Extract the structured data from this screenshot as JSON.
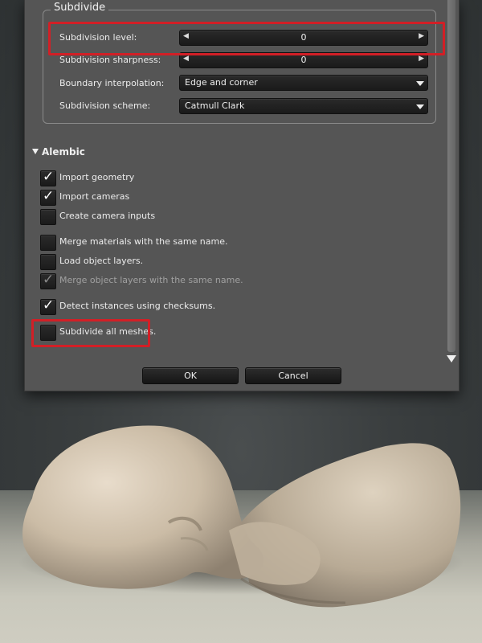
{
  "subdivide": {
    "title": "Subdivide",
    "level": {
      "label": "Subdivision level:",
      "value": "0"
    },
    "sharpness": {
      "label": "Subdivision sharpness:",
      "value": "0"
    },
    "boundary": {
      "label": "Boundary interpolation:",
      "value": "Edge and corner"
    },
    "scheme": {
      "label": "Subdivision scheme:",
      "value": "Catmull Clark"
    }
  },
  "alembic": {
    "title": "Alembic",
    "options": [
      {
        "label": "Import geometry",
        "checked": true,
        "enabled": true
      },
      {
        "label": "Import cameras",
        "checked": true,
        "enabled": true
      },
      {
        "label": "Create camera inputs",
        "checked": false,
        "enabled": true
      },
      {
        "label": "Merge materials with the same name.",
        "checked": false,
        "enabled": true
      },
      {
        "label": "Load object layers.",
        "checked": false,
        "enabled": true
      },
      {
        "label": "Merge object layers with the same name.",
        "checked": true,
        "enabled": false
      },
      {
        "label": "Detect instances using checksums.",
        "checked": true,
        "enabled": true
      },
      {
        "label": "Subdivide all meshes.",
        "checked": false,
        "enabled": true
      }
    ]
  },
  "buttons": {
    "ok": "OK",
    "cancel": "Cancel"
  },
  "colors": {
    "highlight": "#d21f26",
    "dialog_bg": "#555555"
  }
}
